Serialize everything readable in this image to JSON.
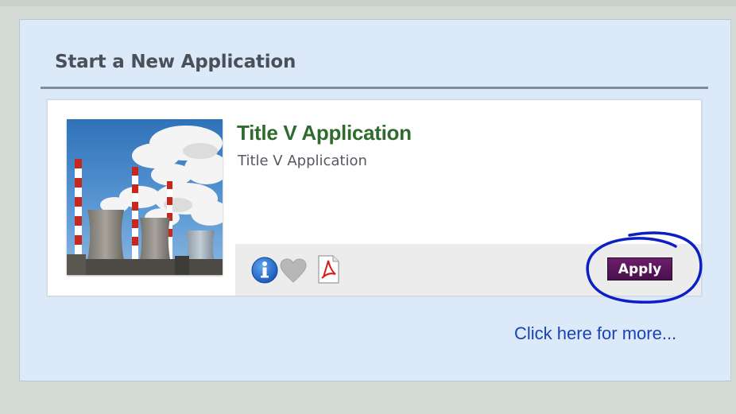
{
  "panel": {
    "title": "Start a New Application"
  },
  "card": {
    "title": "Title V Application",
    "subtitle": "Title V Application",
    "thumbnail_subject": "power plant with cooling towers and smokestacks",
    "actions": {
      "icons": [
        "info-icon",
        "heart-icon",
        "pdf-icon"
      ],
      "apply_label": "Apply",
      "apply_color": "#5a165c"
    }
  },
  "footer": {
    "more_link": "Click here for more..."
  },
  "annotation": {
    "shape": "hand-drawn circle around Apply button",
    "color": "#0b1fc4"
  }
}
